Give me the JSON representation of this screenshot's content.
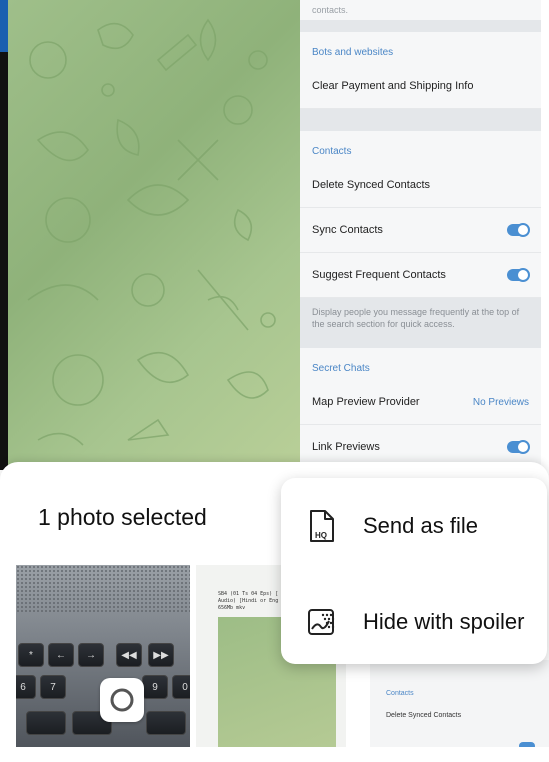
{
  "settings": {
    "top_fragment": "contacts.",
    "bots_header": "Bots and websites",
    "clear_payment": "Clear Payment and Shipping Info",
    "contacts_header": "Contacts",
    "delete_synced": "Delete Synced Contacts",
    "sync_contacts": "Sync Contacts",
    "suggest_frequent": "Suggest Frequent Contacts",
    "suggest_note": "Display people you message frequently at the top of the search section for quick access.",
    "secret_header": "Secret Chats",
    "map_preview": "Map Preview Provider",
    "map_preview_value": "No Previews",
    "link_previews": "Link Previews"
  },
  "sheet": {
    "title": "1 photo selected"
  },
  "thumbs": {
    "keyboard_keys": [
      "*",
      "←",
      "→",
      "◀◀",
      "▶▶",
      "6",
      "7",
      "9",
      "0"
    ],
    "screenshot_text": "SB4 (01 Ts 04 Eps) [\nAudio) [Hindi or Eng\n656Mb mkv",
    "settings_header": "Contacts",
    "settings_row": "Delete Synced Contacts"
  },
  "popup": {
    "items": [
      {
        "label": "Send as file",
        "icon": "hq-file-icon"
      },
      {
        "label": "Hide with spoiler",
        "icon": "spoiler-icon"
      }
    ]
  },
  "colors": {
    "accent": "#4a8fd2",
    "header_blue": "#4a86c6",
    "wallpaper": "#9fbf8a"
  }
}
